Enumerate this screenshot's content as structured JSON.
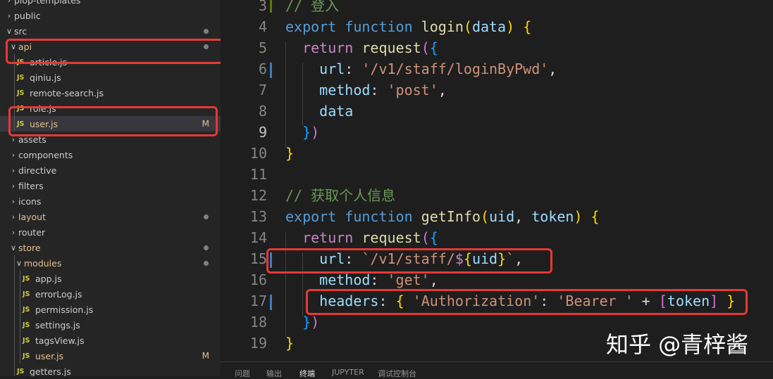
{
  "explorer": {
    "rows": [
      {
        "label": "plop-templates",
        "kind": "folder",
        "open": false
      },
      {
        "label": "public",
        "kind": "folder",
        "open": false
      },
      {
        "label": "src",
        "kind": "folder",
        "open": true,
        "dot": true
      },
      {
        "label": "api",
        "kind": "folder",
        "open": true,
        "dot": true,
        "modified": true
      },
      {
        "label": "article.js",
        "kind": "file",
        "icon": "JS"
      },
      {
        "label": "qiniu.js",
        "kind": "file",
        "icon": "JS"
      },
      {
        "label": "remote-search.js",
        "kind": "file",
        "icon": "JS"
      },
      {
        "label": "role.js",
        "kind": "file",
        "icon": "JS"
      },
      {
        "label": "user.js",
        "kind": "file",
        "icon": "JS",
        "badge": "M",
        "selected": true,
        "modified": true
      },
      {
        "label": "assets",
        "kind": "folder",
        "open": false
      },
      {
        "label": "components",
        "kind": "folder",
        "open": false
      },
      {
        "label": "directive",
        "kind": "folder",
        "open": false
      },
      {
        "label": "filters",
        "kind": "folder",
        "open": false
      },
      {
        "label": "icons",
        "kind": "folder",
        "open": false
      },
      {
        "label": "layout",
        "kind": "folder",
        "open": false,
        "dot": true,
        "modified": true
      },
      {
        "label": "router",
        "kind": "folder",
        "open": false
      },
      {
        "label": "store",
        "kind": "folder",
        "open": true,
        "dot": true,
        "modified": true
      },
      {
        "label": "modules",
        "kind": "folder",
        "open": true,
        "dot": true,
        "modified": true
      },
      {
        "label": "app.js",
        "kind": "file",
        "icon": "JS"
      },
      {
        "label": "errorLog.js",
        "kind": "file",
        "icon": "JS"
      },
      {
        "label": "permission.js",
        "kind": "file",
        "icon": "JS"
      },
      {
        "label": "settings.js",
        "kind": "file",
        "icon": "JS"
      },
      {
        "label": "tagsView.js",
        "kind": "file",
        "icon": "JS"
      },
      {
        "label": "user.js",
        "kind": "file",
        "icon": "JS",
        "badge": "M",
        "modified": true
      },
      {
        "label": "getters.js",
        "kind": "file",
        "icon": "JS"
      }
    ]
  },
  "editor": {
    "lines": [
      {
        "n": "3",
        "tokens": [
          [
            "cm",
            "// 登入"
          ]
        ]
      },
      {
        "n": "4",
        "tokens": [
          [
            "kw",
            "export"
          ],
          [
            "op",
            " "
          ],
          [
            "kw",
            "function"
          ],
          [
            "op",
            " "
          ],
          [
            "fn",
            "login"
          ],
          [
            "br1",
            "("
          ],
          [
            "var",
            "data"
          ],
          [
            "br1",
            ")"
          ],
          [
            "op",
            " "
          ],
          [
            "br1",
            "{"
          ]
        ]
      },
      {
        "n": "5",
        "tokens": [
          [
            "op",
            "  "
          ],
          [
            "kw2",
            "return"
          ],
          [
            "op",
            " "
          ],
          [
            "fn",
            "request"
          ],
          [
            "br2",
            "("
          ],
          [
            "br3",
            "{"
          ]
        ]
      },
      {
        "n": "6",
        "tokens": [
          [
            "op",
            "    "
          ],
          [
            "var",
            "url"
          ],
          [
            "op",
            ": "
          ],
          [
            "str",
            "'/v1/staff/loginByPwd'"
          ],
          [
            "op",
            ","
          ]
        ]
      },
      {
        "n": "7",
        "tokens": [
          [
            "op",
            "    "
          ],
          [
            "var",
            "method"
          ],
          [
            "op",
            ": "
          ],
          [
            "str",
            "'post'"
          ],
          [
            "op",
            ","
          ]
        ]
      },
      {
        "n": "8",
        "tokens": [
          [
            "op",
            "    "
          ],
          [
            "var",
            "data"
          ]
        ]
      },
      {
        "n": "9",
        "tokens": [
          [
            "op",
            "  "
          ],
          [
            "br3",
            "}"
          ],
          [
            "br2",
            ")"
          ]
        ]
      },
      {
        "n": "10",
        "tokens": [
          [
            "br1",
            "}"
          ]
        ]
      },
      {
        "n": "11",
        "tokens": []
      },
      {
        "n": "12",
        "tokens": [
          [
            "cm",
            "// 获取个人信息"
          ]
        ]
      },
      {
        "n": "13",
        "tokens": [
          [
            "kw",
            "export"
          ],
          [
            "op",
            " "
          ],
          [
            "kw",
            "function"
          ],
          [
            "op",
            " "
          ],
          [
            "fn",
            "getInfo"
          ],
          [
            "br1",
            "("
          ],
          [
            "var",
            "uid"
          ],
          [
            "op",
            ", "
          ],
          [
            "var",
            "token"
          ],
          [
            "br1",
            ")"
          ],
          [
            "op",
            " "
          ],
          [
            "br1",
            "{"
          ]
        ]
      },
      {
        "n": "14",
        "tokens": [
          [
            "op",
            "  "
          ],
          [
            "kw2",
            "return"
          ],
          [
            "op",
            " "
          ],
          [
            "fn",
            "request"
          ],
          [
            "br2",
            "("
          ],
          [
            "br3",
            "{"
          ]
        ]
      },
      {
        "n": "15",
        "tokens": [
          [
            "op",
            "    "
          ],
          [
            "var",
            "url"
          ],
          [
            "op",
            ": "
          ],
          [
            "str",
            "`/v1/staff/"
          ],
          [
            "kw2",
            "$"
          ],
          [
            "br1",
            "{"
          ],
          [
            "var",
            "uid"
          ],
          [
            "br1",
            "}"
          ],
          [
            "str",
            "`"
          ],
          [
            "op",
            ","
          ]
        ]
      },
      {
        "n": "16",
        "tokens": [
          [
            "op",
            "    "
          ],
          [
            "var",
            "method"
          ],
          [
            "op",
            ": "
          ],
          [
            "str",
            "'get'"
          ],
          [
            "op",
            ","
          ]
        ]
      },
      {
        "n": "17",
        "tokens": [
          [
            "op",
            "    "
          ],
          [
            "var",
            "headers"
          ],
          [
            "op",
            ": "
          ],
          [
            "br1",
            "{"
          ],
          [
            "op",
            " "
          ],
          [
            "str",
            "'Authorization'"
          ],
          [
            "op",
            ": "
          ],
          [
            "str",
            "'Bearer '"
          ],
          [
            "op",
            " + "
          ],
          [
            "br2",
            "["
          ],
          [
            "var",
            "token"
          ],
          [
            "br2",
            "]"
          ],
          [
            "op",
            " "
          ],
          [
            "br1",
            "}"
          ]
        ]
      },
      {
        "n": "18",
        "tokens": [
          [
            "op",
            "  "
          ],
          [
            "br3",
            "}"
          ],
          [
            "br2",
            ")"
          ]
        ]
      },
      {
        "n": "19",
        "tokens": [
          [
            "br1",
            "}"
          ]
        ]
      }
    ],
    "active_line": "9"
  },
  "panel": {
    "tabs": [
      "问题",
      "输出",
      "终端",
      "JUPYTER",
      "调试控制台"
    ],
    "active_tab": "终端"
  },
  "watermark": "知乎 @青梓酱",
  "colors": {
    "highlight_box": "#e53935",
    "modified": "#e2c08d",
    "js_icon": "#cbcb41"
  }
}
